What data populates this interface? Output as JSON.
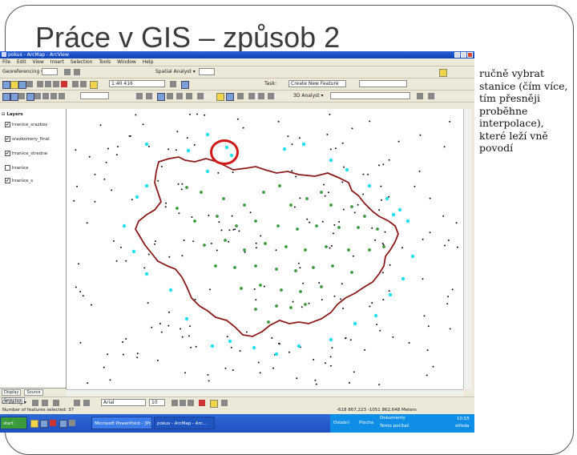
{
  "slide": {
    "title": "Práce v GIS – způsob 2",
    "note": "ručně vybrat stanice (čím více, tím přesněji proběhne interpolace), které leží vně povodí"
  },
  "window": {
    "title": "pokus - ArcMap - ArcView"
  },
  "menu": [
    "File",
    "Edit",
    "View",
    "Insert",
    "Selection",
    "Tools",
    "Window",
    "Help"
  ],
  "toolbar": {
    "georeferencing": "Georeferencing ▾",
    "scale": "1:40 416",
    "spatial_analyst": "Spatial Analyst ▾",
    "task_target": "Create New Feature",
    "layer_combo": "3D Analyst ▾"
  },
  "toc": {
    "root": "Layers",
    "layers": [
      {
        "name": "hranice_srazkov",
        "checked": true
      },
      {
        "name": "srazkomery_final",
        "checked": true
      },
      {
        "name": "hranice_stredne",
        "checked": true
      },
      {
        "name": "hranice",
        "checked": false
      },
      {
        "name": "hranice_s",
        "checked": true
      }
    ],
    "tabs": [
      "Display",
      "Source",
      "Selection"
    ]
  },
  "drawing": {
    "label": "Drawing ▾",
    "font": "Arial",
    "size": "10"
  },
  "status": {
    "left": "Number of features selected: 37",
    "coords": "-618 867,223  -1051 862,648 Meters"
  },
  "taskbar": {
    "items": [
      "Microsoft PowerPoint - [Pr...",
      "pokus - ArcMap - Arc..."
    ],
    "tray": [
      "Ostatní",
      "Plocha",
      "Dokumenty",
      "Tento počítač"
    ],
    "time": "10:55",
    "day": "středa"
  },
  "colors": {
    "boundary": "#8b1a1a",
    "station_inside": "#3a9a3a",
    "station_selected": "#22e0f0",
    "station_other": "#111111",
    "highlight_circle": "#d01818"
  }
}
